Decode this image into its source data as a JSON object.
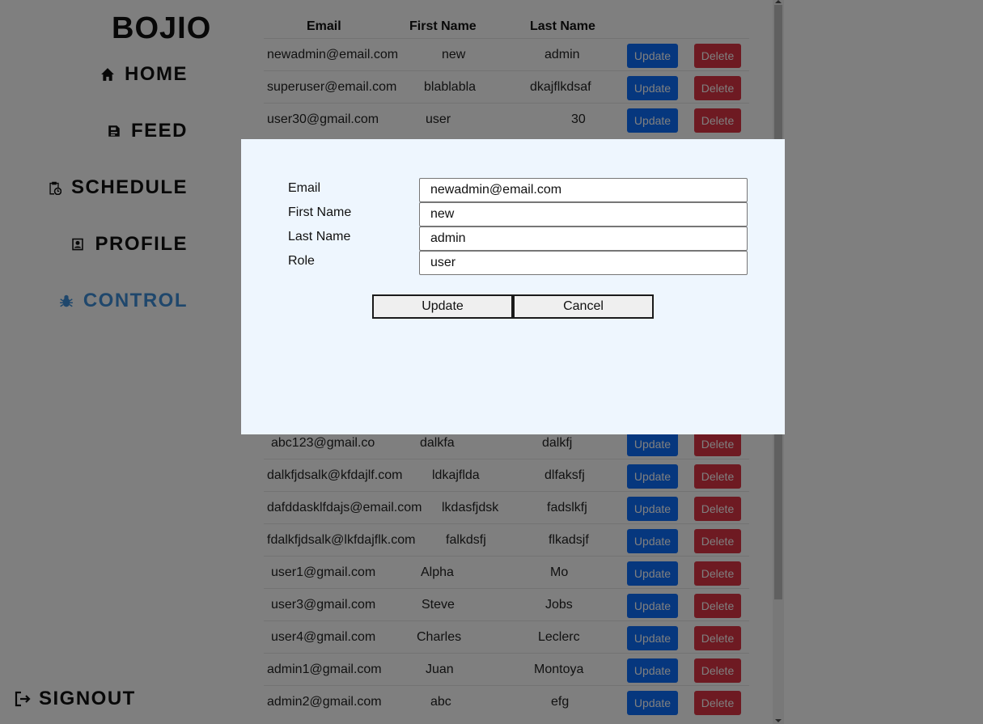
{
  "sidebar": {
    "brand": "BOJIO",
    "nav": [
      {
        "label": "HOME"
      },
      {
        "label": "FEED"
      },
      {
        "label": "SCHEDULE"
      },
      {
        "label": "PROFILE"
      },
      {
        "label": "CONTROL"
      }
    ],
    "signout": "SIGNOUT",
    "active_color": "#3f8fd8"
  },
  "table": {
    "headers": [
      "Email",
      "First Name",
      "Last Name"
    ],
    "update_label": "Update",
    "delete_label": "Delete",
    "update_color": "#0d6efd",
    "delete_color": "#dc3545",
    "rows": [
      {
        "email": "newadmin@email.com",
        "first": "new",
        "last": "admin"
      },
      {
        "email": "superuser@email.com",
        "first": "blablabla",
        "last": "dkajflkdsaf"
      },
      {
        "email": "user30@gmail.com",
        "first": "user",
        "last": "30"
      },
      {
        "email": "abc123@gmail.co",
        "first": "dalkfa",
        "last": "dalkfj"
      },
      {
        "email": "dalkfjdsalk@kfdajlf.com",
        "first": "ldkajflda",
        "last": "dlfaksfj"
      },
      {
        "email": "dafddasklfdajs@email.com",
        "first": "lkdasfjdsk",
        "last": "fadslkfj"
      },
      {
        "email": "fdalkfjdsalk@lkfdajflk.com",
        "first": "falkdsfj",
        "last": "flkadsjf"
      },
      {
        "email": "user1@gmail.com",
        "first": "Alpha",
        "last": "Mo"
      },
      {
        "email": "user3@gmail.com",
        "first": "Steve",
        "last": "Jobs"
      },
      {
        "email": "user4@gmail.com",
        "first": "Charles",
        "last": "Leclerc"
      },
      {
        "email": "admin1@gmail.com",
        "first": "Juan",
        "last": "Montoya"
      },
      {
        "email": "admin2@gmail.com",
        "first": "abc",
        "last": "efg"
      }
    ]
  },
  "modal": {
    "fields": [
      {
        "label": "Email",
        "value": "newadmin@email.com"
      },
      {
        "label": "First Name",
        "value": "new"
      },
      {
        "label": "Last Name",
        "value": "admin"
      },
      {
        "label": "Role",
        "value": "user"
      }
    ],
    "update_label": "Update",
    "cancel_label": "Cancel",
    "background": "#eef6fe"
  }
}
